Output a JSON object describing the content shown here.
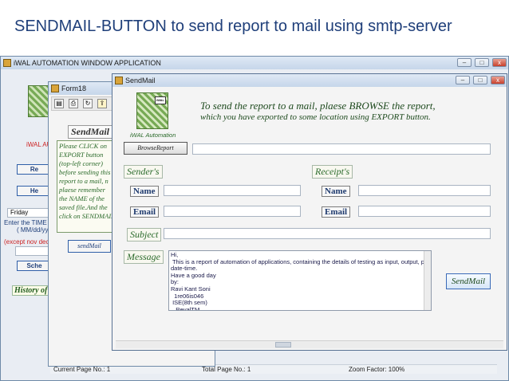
{
  "slide_title": "SENDMAIL-BUTTON  to send report to mail using smtp-server",
  "main_window": {
    "title": "iWAL AUTOMATION WINDOW APPLICATION",
    "logo_text": "iWAL AU",
    "buttons": [
      "Re",
      "He",
      "Sche"
    ],
    "day_value": "Friday",
    "time_label_1": "Enter the TIME a",
    "time_label_2": "( MM/dd/yy",
    "except_label": "(except nov  dec",
    "history_label": "History of",
    "status": {
      "current_page": "Current Page No.: 1",
      "total_page": "Total Page No.: 1",
      "zoom": "Zoom Factor: 100%"
    }
  },
  "form18": {
    "title": "Form18",
    "sendmail_heading": "SendMail",
    "instructions": "Please CLICK on EXPORT button (top-left corner) before sending this report to a mail, n plaese remember the NAME of the saved file.And the click on   SENDMAIL",
    "sendmail_button": "sendMail"
  },
  "sendmail_window": {
    "title": "SendMail",
    "logo_badge": "iWAL",
    "logo_text": "iWAL Automation",
    "headline_line1": "To send the report to  a  mail, plaese BROWSE the report,",
    "headline_line2": "which you have exported to some location using EXPORT button.",
    "browse_button": "BrowseReport",
    "sender_label": "Sender's",
    "receipt_label": "Receipt's",
    "name_label": "Name",
    "email_label": "Email",
    "subject_label": "Subject",
    "message_label": "Message",
    "message_body": "Hi,\n This is a report of automation of applications, containing the details of testing as input, output, pass/fail,\ndate-time.\nHave a good day\nby:\nRavi Kant Soni\n  1re06is046\n ISE(8th sem)\n   RevalTM",
    "send_button": "SendMail"
  },
  "icons": [
    "app-icon",
    "minimize-icon",
    "maximize-icon",
    "close-icon",
    "save-icon",
    "print-icon",
    "refresh-icon",
    "export-icon"
  ]
}
